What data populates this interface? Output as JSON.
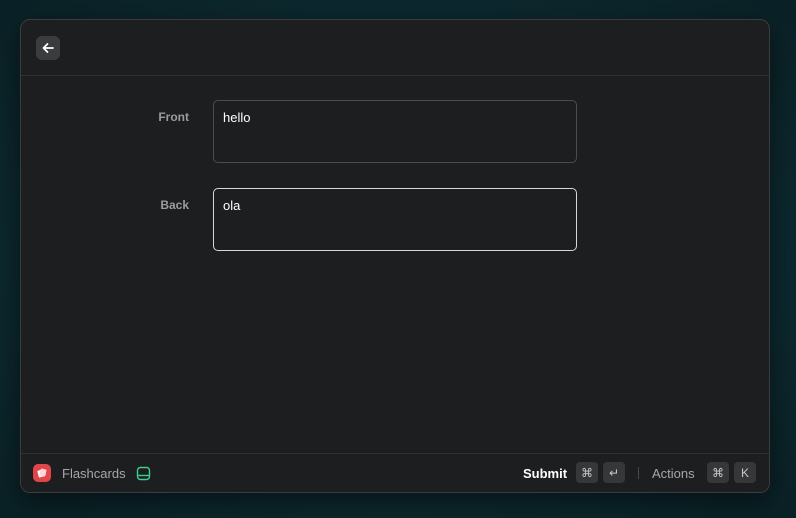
{
  "header": {
    "back_icon": "arrow-left-icon"
  },
  "form": {
    "front": {
      "label": "Front",
      "value": "hello"
    },
    "back": {
      "label": "Back",
      "value": "ola"
    }
  },
  "footer": {
    "app_icon": "flashcards-app-icon",
    "app_name": "Flashcards",
    "drawer_icon": "drawer-icon",
    "submit_label": "Submit",
    "submit_shortcut": [
      "⌘",
      "↵"
    ],
    "actions_label": "Actions",
    "actions_shortcut": [
      "⌘",
      "K"
    ]
  },
  "colors": {
    "app_icon_bg": "#e0454a",
    "drawer_icon": "#3ecf8e",
    "window_bg": "#1c1e20"
  }
}
